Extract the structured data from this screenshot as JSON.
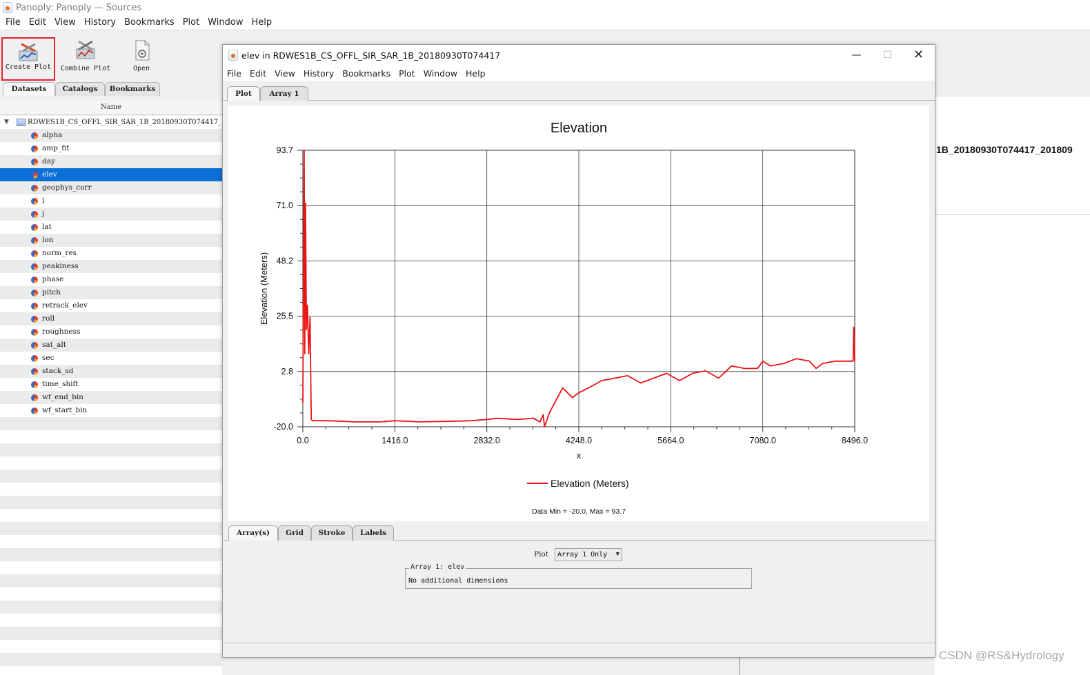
{
  "main_window": {
    "title": "Panoply: Panoply — Sources",
    "menu": [
      "File",
      "Edit",
      "View",
      "History",
      "Bookmarks",
      "Plot",
      "Window",
      "Help"
    ],
    "toolbar": {
      "create_plot": "Create Plot",
      "combine_plot": "Combine Plot",
      "open": "Open"
    },
    "source_tabs": [
      "Datasets",
      "Catalogs",
      "Bookmarks"
    ],
    "tree_header": "Name",
    "file_name": "RDWES1B_CS_OFFL_SIR_SAR_1B_20180930T074417_20180",
    "variables": [
      "alpha",
      "amp_fit",
      "day",
      "elev",
      "geophys_corr",
      "i",
      "j",
      "lat",
      "lon",
      "norm_res",
      "peakiness",
      "phase",
      "pitch",
      "retrack_elev",
      "roll",
      "roughness",
      "sat_alt",
      "sec",
      "stack_sd",
      "time_shift",
      "wf_end_bin",
      "wf_start_bin"
    ],
    "selected_variable": "elev",
    "right_panel_title": "1B_20180930T074417_201809"
  },
  "plot_window": {
    "title": "elev in RDWES1B_CS_OFFL_SIR_SAR_1B_20180930T074417",
    "controls": {
      "minimize": "—",
      "maximize": "☐",
      "close": "✕"
    },
    "menu": [
      "File",
      "Edit",
      "View",
      "History",
      "Bookmarks",
      "Plot",
      "Window",
      "Help"
    ],
    "tabs": [
      "Plot",
      "Array 1"
    ],
    "settings_tabs": [
      "Array(s)",
      "Grid",
      "Stroke",
      "Labels"
    ],
    "plot_select_label": "Plot",
    "plot_select_value": "Array 1 Only",
    "array_group_title": "Array 1: elev",
    "array_group_text": "No additional dimensions"
  },
  "chart_data": {
    "type": "line",
    "title": "Elevation",
    "xlabel": "x",
    "ylabel": "Elevation (Meters)",
    "xlim": [
      0,
      8496
    ],
    "ylim": [
      -20.0,
      93.7
    ],
    "x_ticks": [
      "0.0",
      "1416.0",
      "2832.0",
      "4248.0",
      "5664.0",
      "7080.0",
      "8496.0"
    ],
    "y_ticks": [
      "-20.0",
      "2.8",
      "25.5",
      "48.2",
      "71.0",
      "93.7"
    ],
    "grid": true,
    "legend_position": "bottom-center",
    "color": "#ee1111",
    "footer": "Data Min = -20.0, Max = 93.7",
    "series": [
      {
        "name": "Elevation (Meters)",
        "x": [
          0,
          20,
          30,
          40,
          55,
          70,
          90,
          110,
          130,
          150,
          200,
          400,
          800,
          1200,
          1416,
          1800,
          2200,
          2600,
          2832,
          3000,
          3300,
          3550,
          3650,
          3700,
          3720,
          3800,
          4000,
          4150,
          4248,
          4400,
          4600,
          4800,
          5000,
          5200,
          5400,
          5600,
          5664,
          5800,
          6000,
          6200,
          6400,
          6600,
          6800,
          7000,
          7080,
          7200,
          7400,
          7600,
          7800,
          7900,
          8000,
          8200,
          8400,
          8470,
          8480,
          8496
        ],
        "y": [
          -10,
          93.7,
          10,
          72,
          20,
          30,
          10,
          25,
          -17,
          -17.5,
          -17.5,
          -17.5,
          -18,
          -18,
          -17.5,
          -18,
          -17.8,
          -17.5,
          -17,
          -16.5,
          -17,
          -16.5,
          -18,
          -15,
          -20,
          -14,
          -4,
          -8,
          -6,
          -4,
          -1,
          0,
          1,
          -2,
          0,
          2,
          1,
          -1,
          2,
          3,
          0,
          5,
          4,
          4,
          7,
          5,
          6,
          8,
          7,
          4,
          6,
          7,
          7,
          7,
          21,
          7
        ]
      }
    ]
  },
  "watermark": "CSDN @RS&Hydrology"
}
